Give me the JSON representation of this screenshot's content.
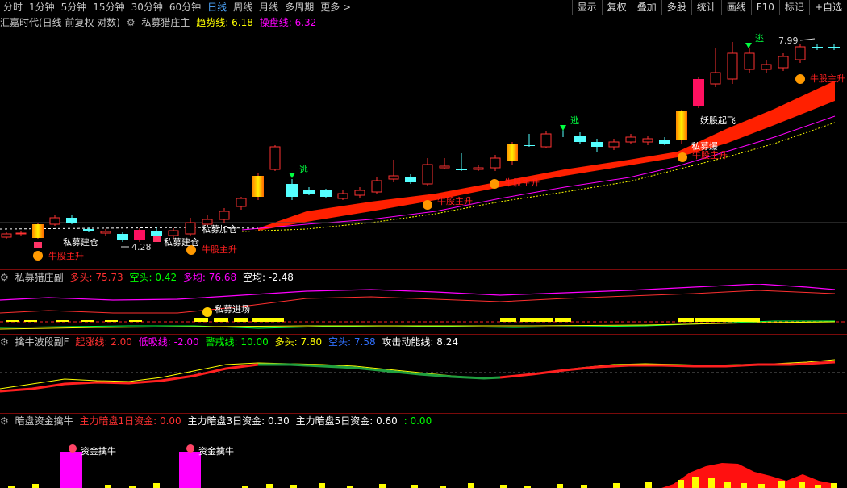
{
  "toolbar": {
    "periods": [
      "分时",
      "1分钟",
      "5分钟",
      "15分钟",
      "30分钟",
      "60分钟",
      "日线",
      "周线",
      "月线",
      "多周期",
      "更多 >"
    ],
    "active_period": "日线",
    "tools": [
      "显示",
      "复权",
      "叠加",
      "多股",
      "统计",
      "画线",
      "F10",
      "标记",
      "+自选"
    ]
  },
  "main_panel": {
    "stock": "汇嘉时代(日线 前复权 对数)",
    "indicator": "私募猎庄主",
    "trend_label": "趋势线:",
    "trend_value": "6.18",
    "disk_label": "操盘线:",
    "disk_value": "6.32",
    "high_price": "7.99",
    "low_price": "4.28",
    "signals": {
      "escape": "逃",
      "bull_rise": "牛股主升",
      "private_build": "私募建仓",
      "private_add": "私募加仓",
      "private_burst": "私募爆",
      "demon_fly": "妖股起飞"
    }
  },
  "panel2": {
    "title": "私募猎庄副",
    "long_label": "多头:",
    "long_value": "75.73",
    "empty_label": "空头:",
    "empty_value": "0.42",
    "avg_label": "多均:",
    "avg_value": "76.68",
    "eavg_label": "空均:",
    "eavg_value": "-2.48",
    "signal": "私募进场"
  },
  "panel3": {
    "title": "擒牛波段副F",
    "rise_label": "起涨线:",
    "rise_value": "2.00",
    "low_label": "低吸线:",
    "low_value": "-2.00",
    "warn_label": "警戒线:",
    "warn_value": "10.00",
    "long_label": "多头:",
    "long_value": "7.80",
    "empty_label": "空头:",
    "empty_value": "7.58",
    "attack_label": "攻击动能线:",
    "attack_value": "8.24"
  },
  "panel4": {
    "title": "暗盘资金擒牛",
    "f1_label": "主力暗盘1日资金:",
    "f1_value": "0.00",
    "f3_label": "主力暗盘3日资金:",
    "f3_value": "0.30",
    "f5_label": "主力暗盘5日资金:",
    "f5_value": "0.60",
    "tail_value": ": 0.00",
    "signal": "资金擒牛"
  },
  "colors": {
    "up": "#ff3232",
    "down": "#54ffff",
    "band": "#ff2000",
    "trend": "#ffff00",
    "disk": "#ff00ff",
    "active_tab": "#4fa8ff"
  }
}
